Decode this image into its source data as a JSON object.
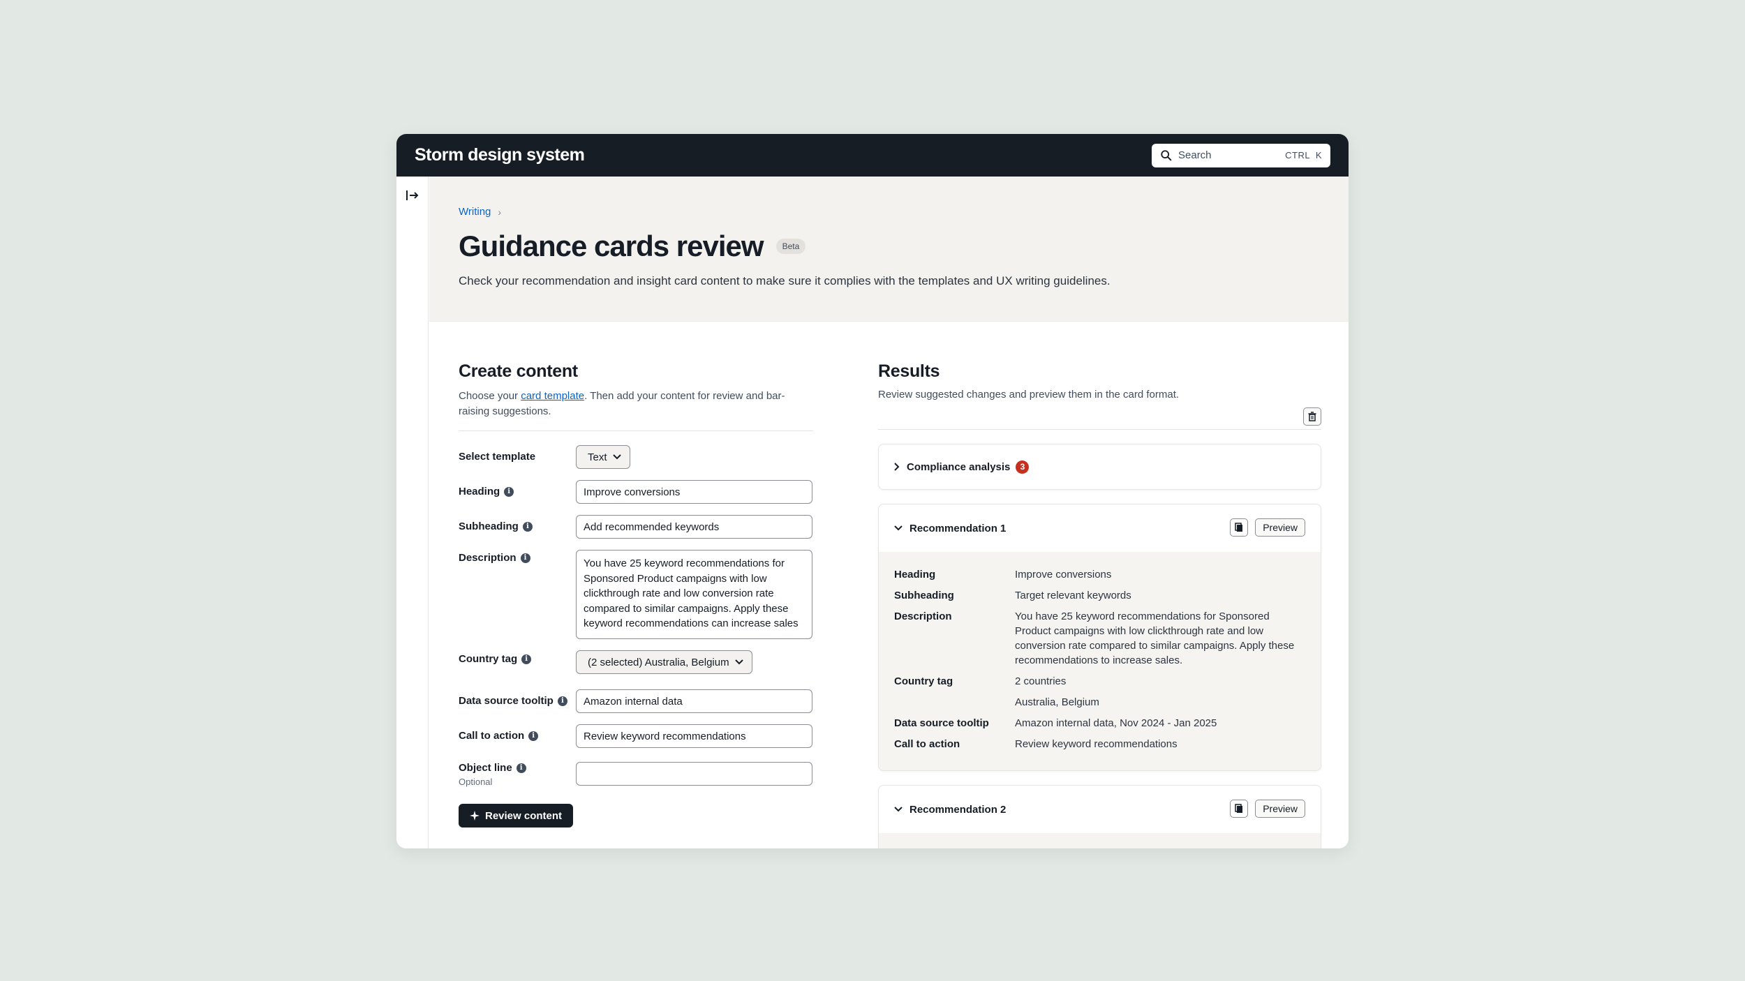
{
  "app": {
    "logo": "Storm design system",
    "search_placeholder": "Search",
    "search_shortcut": "CTRL  K"
  },
  "header": {
    "breadcrumb": [
      "Writing"
    ],
    "title": "Guidance cards review",
    "badge": "Beta",
    "description": "Check your recommendation and insight card content to make sure it complies with the templates and UX writing guidelines."
  },
  "create": {
    "title": "Create content",
    "sub_prefix": "Choose your ",
    "sub_link": "card template",
    "sub_suffix": ". Then add your content for review and bar-raising suggestions.",
    "fields": {
      "template_label": "Select template",
      "template_value": "Text",
      "heading_label": "Heading",
      "heading_value": "Improve conversions",
      "subheading_label": "Subheading",
      "subheading_value": "Add recommended keywords",
      "description_label": "Description",
      "description_value": "You have 25 keyword recommendations for Sponsored Product campaigns with low clickthrough rate and low conversion rate compared to similar campaigns. Apply these keyword recommendations can increase sales",
      "country_label": "Country tag",
      "country_value": "(2 selected) Australia, Belgium",
      "datasource_label": "Data source tooltip",
      "datasource_value": "Amazon internal data",
      "cta_label": "Call to action",
      "cta_value": "Review keyword recommendations",
      "object_label": "Object line",
      "object_optional": "Optional",
      "object_value": ""
    },
    "review_button": "Review content"
  },
  "results": {
    "title": "Results",
    "sub": "Review suggested changes and preview them in the card format.",
    "compliance": {
      "label": "Compliance analysis",
      "count": "3"
    },
    "rec1": {
      "title": "Recommendation 1",
      "preview": "Preview",
      "rows": [
        {
          "k": "Heading",
          "v": "Improve conversions"
        },
        {
          "k": "Subheading",
          "v": "Target relevant keywords"
        },
        {
          "k": "Description",
          "v": "You have 25 keyword recommendations for Sponsored Product campaigns with low clickthrough rate and low conversion rate compared to similar campaigns. Apply these recommendations to increase sales."
        },
        {
          "k": "Country tag",
          "v": "2 countries"
        },
        {
          "k": "",
          "v": "Australia, Belgium"
        },
        {
          "k": "Data source tooltip",
          "v": "Amazon internal data, Nov 2024 - Jan 2025"
        },
        {
          "k": "Call to action",
          "v": "Review keyword recommendations"
        }
      ]
    },
    "rec2": {
      "title": "Recommendation 2",
      "preview": "Preview"
    }
  }
}
